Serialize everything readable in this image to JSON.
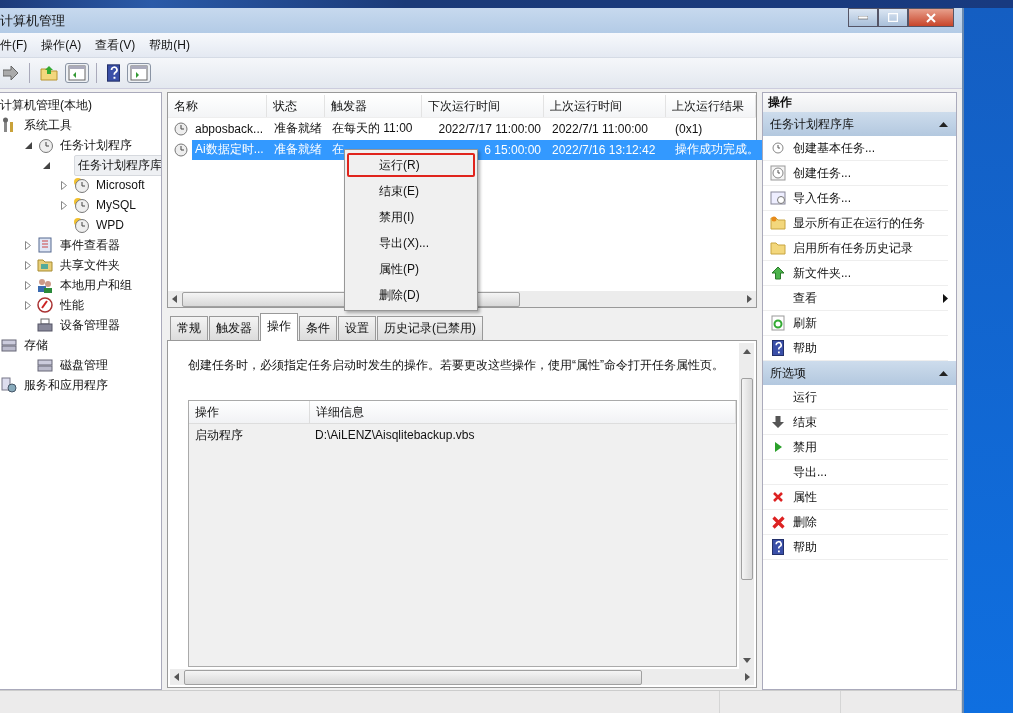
{
  "window": {
    "title": "计算机管理"
  },
  "menu": [
    "件(F)",
    "操作(A)",
    "查看(V)",
    "帮助(H)"
  ],
  "tree": {
    "root": "计算机管理(本地)",
    "items": [
      {
        "label": "系统工具",
        "selected": false,
        "children": [
          {
            "label": "任务计划程序",
            "expanded": true,
            "selected": false,
            "children": [
              {
                "label": "任务计划程序库",
                "expanded": true,
                "selected": true,
                "children": [
                  {
                    "label": "Microsoft",
                    "expanded": false,
                    "selected": false
                  },
                  {
                    "label": "MySQL",
                    "expanded": false,
                    "selected": false
                  },
                  {
                    "label": "WPD",
                    "selected": false
                  }
                ]
              }
            ]
          },
          {
            "label": "事件查看器",
            "expanded": false,
            "selected": false
          },
          {
            "label": "共享文件夹",
            "expanded": false,
            "selected": false
          },
          {
            "label": "本地用户和组",
            "expanded": false,
            "selected": false
          },
          {
            "label": "性能",
            "expanded": false,
            "selected": false
          },
          {
            "label": "设备管理器",
            "selected": false
          }
        ]
      },
      {
        "label": "存储",
        "selected": false,
        "children": [
          {
            "label": "磁盘管理",
            "selected": false
          }
        ]
      },
      {
        "label": "服务和应用程序",
        "selected": false
      }
    ]
  },
  "task_table": {
    "columns": [
      "名称",
      "状态",
      "触发器",
      "下次运行时间",
      "上次运行时间",
      "上次运行结果"
    ],
    "rows": [
      {
        "selected": false,
        "cells": [
          "abposback...",
          "准备就绪",
          "在每天的 11:00",
          "2022/7/17 11:00:00",
          "2022/7/1 11:00:00",
          "(0x1)"
        ]
      },
      {
        "selected": true,
        "cells": [
          "Ai数据定时...",
          "准备就绪",
          "在",
          "6 15:00:00",
          "2022/7/16 13:12:42",
          "操作成功完成。"
        ]
      }
    ]
  },
  "context_menu": [
    {
      "label": "运行(R)",
      "annotated": true
    },
    {
      "label": "结束(E)",
      "annotated": false
    },
    {
      "label": "禁用(I)",
      "annotated": false
    },
    {
      "label": "导出(X)...",
      "annotated": false
    },
    {
      "label": "属性(P)",
      "annotated": false
    },
    {
      "label": "删除(D)",
      "annotated": false
    }
  ],
  "detail_tabs": [
    {
      "label": "常规",
      "selected": false
    },
    {
      "label": "触发器",
      "selected": false
    },
    {
      "label": "操作",
      "selected": true
    },
    {
      "label": "条件",
      "selected": false
    },
    {
      "label": "设置",
      "selected": false
    },
    {
      "label": "历史记录(已禁用)",
      "selected": false
    }
  ],
  "detail": {
    "description": "创建任务时，必须指定任务启动时发生的操作。若要更改这些操作，使用“属性”命令打开任务属性页。",
    "columns": [
      "操作",
      "详细信息"
    ],
    "rows": [
      [
        "启动程序",
        "D:\\AiLENZ\\Aisqlitebackup.vbs"
      ]
    ]
  },
  "actions_pane": {
    "title": "操作",
    "groups": [
      {
        "title": "任务计划程序库",
        "expanded": true,
        "items": [
          {
            "label": "创建基本任务...",
            "submenu": false
          },
          {
            "label": "创建任务...",
            "submenu": false
          },
          {
            "label": "导入任务...",
            "submenu": false
          },
          {
            "label": "显示所有正在运行的任务",
            "submenu": false
          },
          {
            "label": "启用所有任务历史记录",
            "submenu": false
          },
          {
            "label": "新文件夹...",
            "submenu": false
          },
          {
            "label": "查看",
            "submenu": true
          },
          {
            "label": "刷新",
            "submenu": false
          },
          {
            "label": "帮助",
            "submenu": false
          }
        ]
      },
      {
        "title": "所选项",
        "expanded": true,
        "items": [
          {
            "label": "运行",
            "submenu": false
          },
          {
            "label": "结束",
            "submenu": false
          },
          {
            "label": "禁用",
            "submenu": false
          },
          {
            "label": "导出...",
            "submenu": false
          },
          {
            "label": "属性",
            "submenu": false
          },
          {
            "label": "删除",
            "submenu": false
          },
          {
            "label": "帮助",
            "submenu": false
          }
        ]
      }
    ]
  }
}
